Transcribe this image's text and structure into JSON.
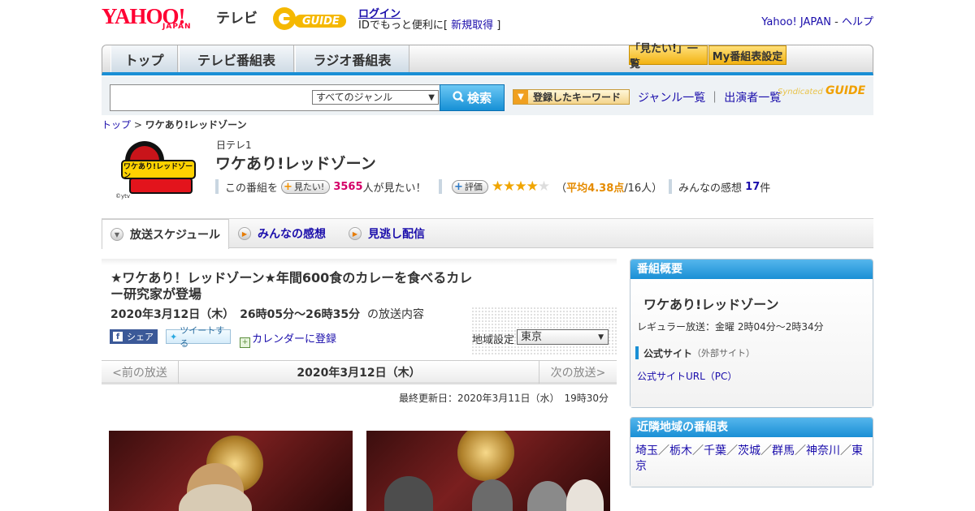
{
  "header": {
    "logo_yahoo": "YAHOO!",
    "logo_japan": "JAPAN",
    "logo_tv": "テレビ",
    "gguide": "GUIDE",
    "login": "ログイン",
    "login_sub_pre": "IDでもっと便利に[",
    "signup": "新規取得",
    "login_sub_post": "]",
    "yahoo_japan": "Yahoo! JAPAN",
    "sep": " - ",
    "help": "ヘルプ"
  },
  "nav": {
    "tabs": [
      "トップ",
      "テレビ番組表",
      "ラジオ番組表"
    ],
    "btn_mitai": "「見たい!」一覧",
    "btn_my": "My番組表設定"
  },
  "search": {
    "genre": "すべてのジャンル",
    "button": "検索",
    "keyword_btn": "登録したキーワード",
    "genre_list": "ジャンル一覧",
    "pipe": "｜",
    "performers": "出演者一覧",
    "syndicated": "Syndicated",
    "syndicated_brand": "GUIDE"
  },
  "breadcrumb": {
    "top": "トップ",
    "sep": " > ",
    "current": "ワケあり!レッドゾーン"
  },
  "program": {
    "image_caption": "ワケあり!レッドゾーン",
    "copyright": "©ytv",
    "channel": "日テレ1",
    "title": "ワケあり!レッドゾーン",
    "this_program": "この番組を",
    "mitai_btn": "見たい!",
    "mitai_count": "3565",
    "mitai_suffix": "人が見たい！",
    "rate_btn": "評価",
    "rating": 4,
    "rating_max": 5,
    "avg_pre": "（",
    "avg": "平均4.38点",
    "avg_post": "/16人）",
    "impressions_label": "みんなの感想",
    "impressions_count": "17",
    "impressions_suffix": "件"
  },
  "tabs": {
    "schedule": "放送スケジュール",
    "impressions": "みんなの感想",
    "streaming": "見逃し配信"
  },
  "episode": {
    "title": "★ワケあり！レッドゾーン★年間600食のカレーを食べるカレー研究家が登場",
    "air_time": "2020年3月12日（木）　26時05分～26時35分",
    "air_suffix": "の放送内容",
    "fb": "シェア",
    "tweet": "ツイートする",
    "calendar": "カレンダーに登録",
    "region_label": "地域設定",
    "region": "東京",
    "prev": "<前の放送",
    "date": "2020年3月12日（木）",
    "next": "次の放送>",
    "updated": "最終更新日：2020年3月11日（水）　19時30分"
  },
  "sidebar": {
    "overview_title": "番組概要",
    "name": "ワケあり!レッドゾーン",
    "regular": "レギュラー放送：金曜 2時04分～2時34分",
    "official_label": "公式サイト",
    "official_note": "（外部サイト）",
    "official_link": "公式サイトURL（PC）",
    "nearby_title": "近隣地域の番組表",
    "regions": [
      "埼玉",
      "栃木",
      "千葉",
      "茨城",
      "群馬",
      "神奈川",
      "東京"
    ]
  },
  "colors": {
    "accent": "#1a8fd5",
    "yahoo_red": "#ff0033",
    "count_pink": "#d40068",
    "star": "#f0a500"
  }
}
